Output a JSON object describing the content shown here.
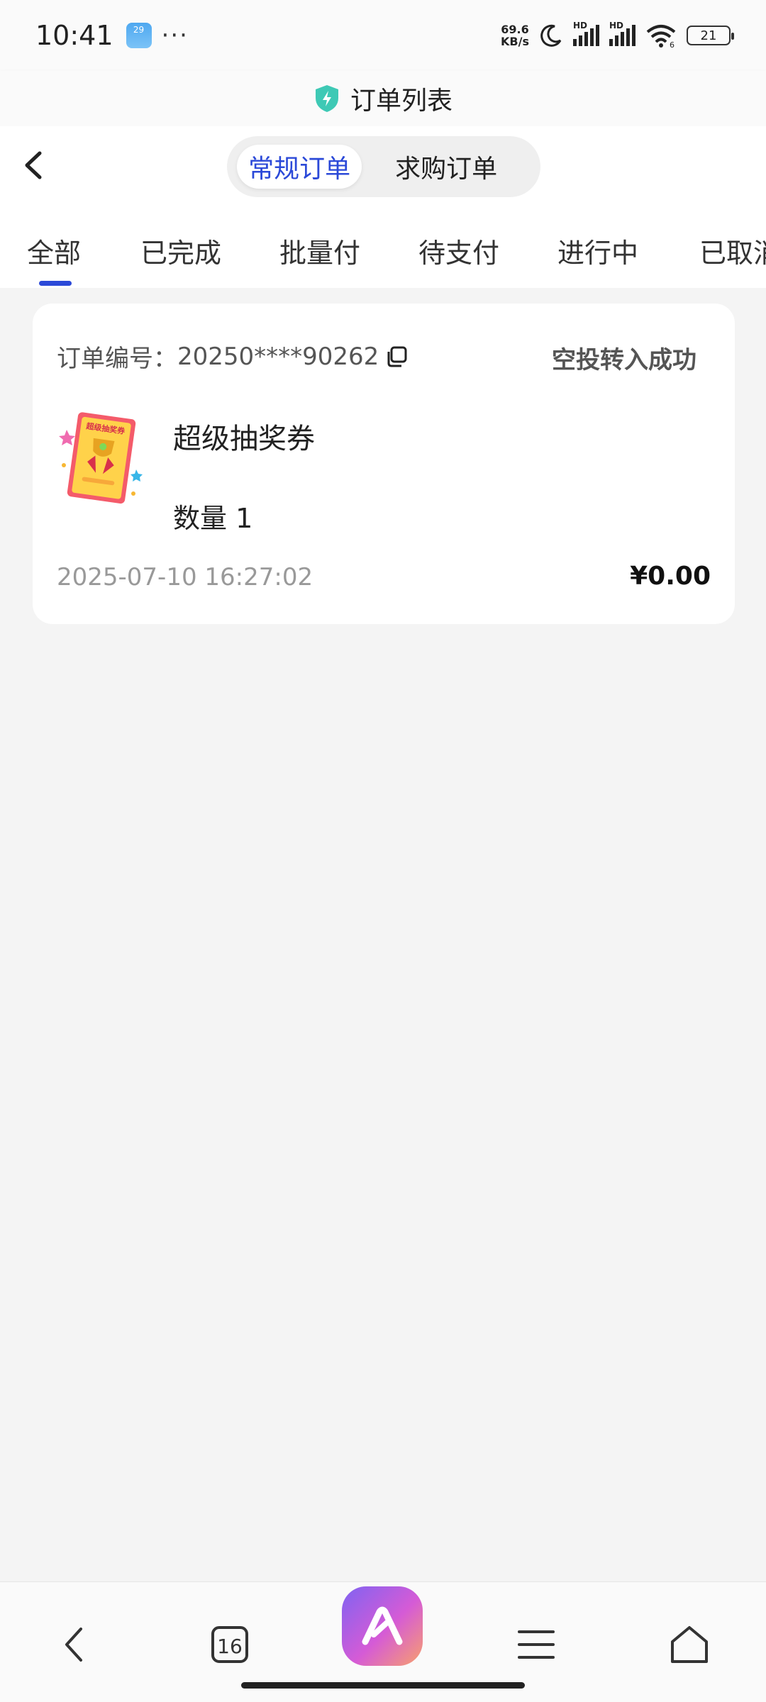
{
  "status_bar": {
    "time": "10:41",
    "weather_badge": "29",
    "more": "···",
    "net_speed_value": "69.6",
    "net_speed_unit": "KB/s",
    "signal_label_1": "HD",
    "signal_label_2": "HD",
    "wifi_label": "6",
    "battery": "21"
  },
  "title_bar": {
    "title": "订单列表",
    "icon": "shield-lightning-icon",
    "icon_color": "#3ec9b5"
  },
  "segments": {
    "regular": "常规订单",
    "purchase": "求购订单",
    "active": "regular"
  },
  "filter_tabs": [
    "全部",
    "已完成",
    "批量付",
    "待支付",
    "进行中",
    "已取消"
  ],
  "active_tab": "全部",
  "order": {
    "number_label": "订单编号：",
    "number": "20250****90262",
    "status": "空投转入成功",
    "product_name": "超级抽奖券",
    "product_image_text": "超级抽奖券",
    "quantity": "数量 1",
    "date": "2025-07-10 16:27:02",
    "price": "¥0.00"
  },
  "bottom_nav": {
    "tab_count": "16",
    "items": [
      "back-icon",
      "tabs-icon",
      "app-logo-icon",
      "menu-icon",
      "home-icon"
    ]
  },
  "colors": {
    "accent": "#2b49d8",
    "background": "#f4f4f4"
  }
}
